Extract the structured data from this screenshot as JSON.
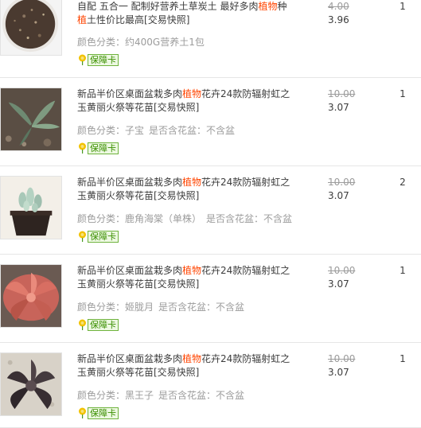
{
  "colors": {
    "highlight": "#ff4400",
    "muted": "#9c9c9c",
    "text": "#3c3c3c",
    "badge_green": "#3a8f00"
  },
  "items": [
    {
      "title_pre": "自配 五合一 配制好营养土草炭土 最好多肉",
      "title_hl": "植物",
      "title_mid": "种",
      "title_hl2": "植",
      "title_post": "土性价比最高[交易快照]",
      "sku_label": "颜色分类：",
      "sku_value": "约400G营养土1包",
      "sku_label2": "",
      "sku_value2": "",
      "badge": "保障卡",
      "price_old": "4.00",
      "price_now": "3.96",
      "qty": "1",
      "icon": "soil-thumbnail"
    },
    {
      "title_pre": "新品半价区桌面盆栽多肉",
      "title_hl": "植物",
      "title_post": "花卉24款防辐射虹之玉黄丽火祭等花苗[交易快照]",
      "sku_label": "颜色分类：",
      "sku_value": "子宝",
      "sku_label2": "是否含花盆：",
      "sku_value2": "不含盆",
      "badge": "保障卡",
      "price_old": "10.00",
      "price_now": "3.07",
      "qty": "1",
      "icon": "succulent-thumbnail"
    },
    {
      "title_pre": "新品半价区桌面盆栽多肉",
      "title_hl": "植物",
      "title_post": "花卉24款防辐射虹之玉黄丽火祭等花苗[交易快照]",
      "sku_label": "颜色分类：",
      "sku_value": "鹿角海棠（单株）",
      "sku_label2": "是否含花盆：",
      "sku_value2": "不含盆",
      "badge": "保障卡",
      "price_old": "10.00",
      "price_now": "3.07",
      "qty": "2",
      "icon": "succulent-thumbnail"
    },
    {
      "title_pre": "新品半价区桌面盆栽多肉",
      "title_hl": "植物",
      "title_post": "花卉24款防辐射虹之玉黄丽火祭等花苗[交易快照]",
      "sku_label": "颜色分类：",
      "sku_value": "姬胧月",
      "sku_label2": "是否含花盆：",
      "sku_value2": "不含盆",
      "badge": "保障卡",
      "price_old": "10.00",
      "price_now": "3.07",
      "qty": "1",
      "icon": "succulent-thumbnail"
    },
    {
      "title_pre": "新品半价区桌面盆栽多肉",
      "title_hl": "植物",
      "title_post": "花卉24款防辐射虹之玉黄丽火祭等花苗[交易快照]",
      "sku_label": "颜色分类：",
      "sku_value": "黑王子",
      "sku_label2": "是否含花盆：",
      "sku_value2": "不含盆",
      "badge": "保障卡",
      "price_old": "10.00",
      "price_now": "3.07",
      "qty": "1",
      "icon": "succulent-thumbnail"
    }
  ]
}
